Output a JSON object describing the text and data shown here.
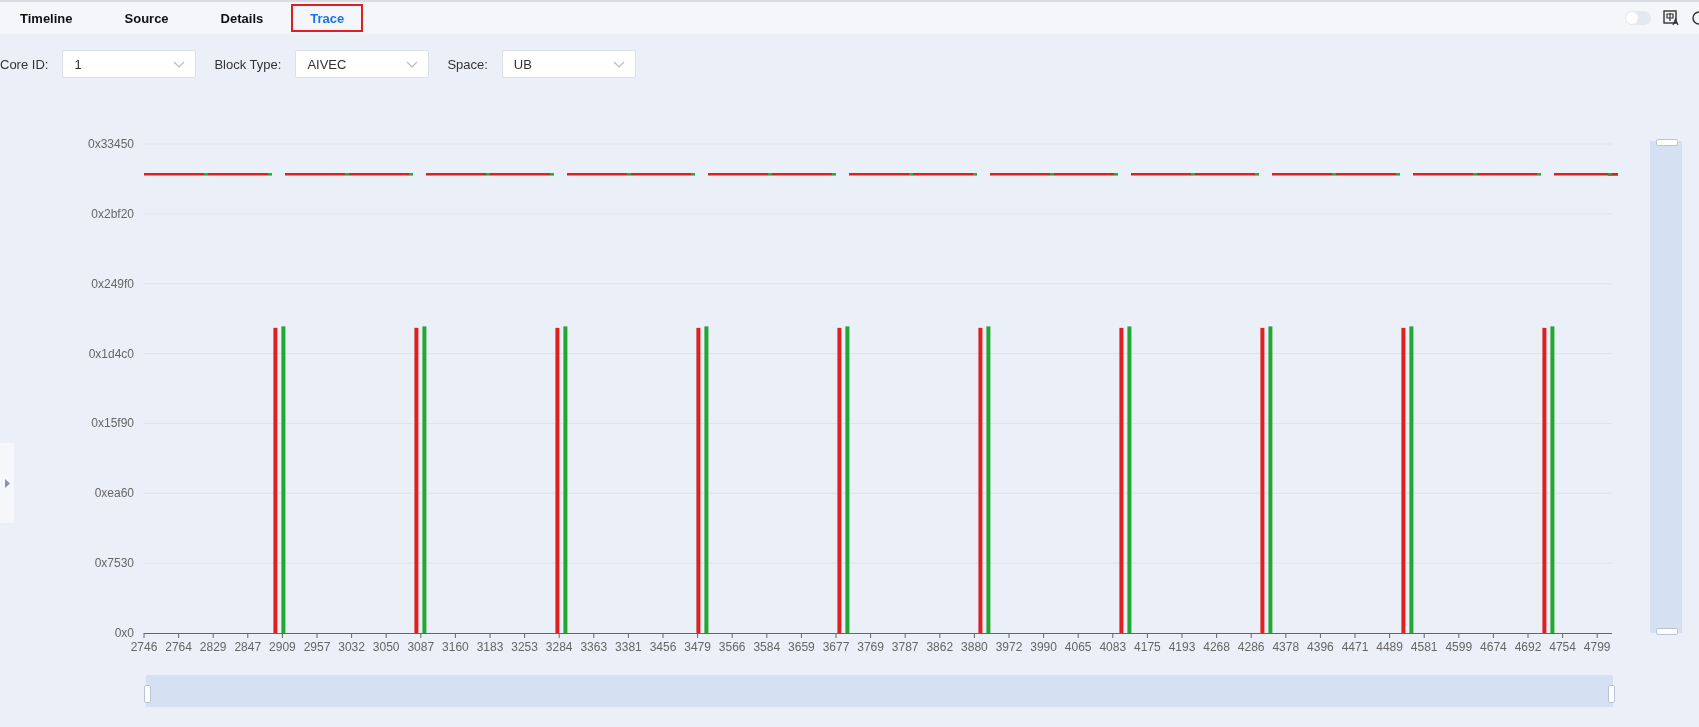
{
  "tabs": [
    {
      "label": "Timeline",
      "selected": false
    },
    {
      "label": "Source",
      "selected": false
    },
    {
      "label": "Details",
      "selected": false
    },
    {
      "label": "Trace",
      "selected": true
    }
  ],
  "header": {
    "toggle_on": false
  },
  "filters": [
    {
      "label": "Core ID:",
      "value": "1"
    },
    {
      "label": "Block Type:",
      "value": "AIVEC"
    },
    {
      "label": "Space:",
      "value": "UB"
    }
  ],
  "vertical_zoom": {
    "level": 1
  },
  "horizontal_zoom": {
    "level": 1
  },
  "trace_chart": {
    "x_axis_labels": [
      "2746",
      "2764",
      "2829",
      "2847",
      "2909",
      "2957",
      "3032",
      "3050",
      "3087",
      "3160",
      "3183",
      "3253",
      "3284",
      "3363",
      "3381",
      "3456",
      "3479",
      "3566",
      "3584",
      "3659",
      "3677",
      "3769",
      "3787",
      "3862",
      "3880",
      "3972",
      "3990",
      "4065",
      "4083",
      "4175",
      "4193",
      "4268",
      "4286",
      "4378",
      "4396",
      "4471",
      "4489",
      "4581",
      "4599",
      "4674",
      "4692",
      "4754",
      "4799"
    ],
    "y_axis_labels": [
      "0x33450",
      "0x2bf20",
      "0x249f0",
      "0x1d4c0",
      "0x15f90",
      "0xea60",
      "0x7530",
      "0x0"
    ]
  }
}
